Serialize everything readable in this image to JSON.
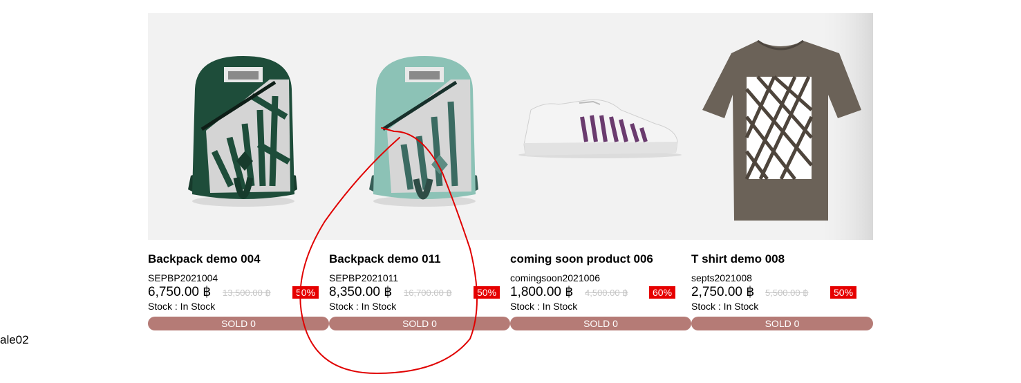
{
  "stray_label": "ale02",
  "products": [
    {
      "title": "Backpack demo 004",
      "sku": "SEPBP2021004",
      "price": "6,750.00 ฿",
      "old_price": "13,500.00 ฿",
      "discount": "50%",
      "stock": "Stock : In Stock",
      "sold": "SOLD 0",
      "image_icon": "dark-green-backpack-image",
      "colors": {
        "body": "#1e4d3a",
        "accent": "#d4d4d4"
      }
    },
    {
      "title": "Backpack demo 011",
      "sku": "SEPBP2021011",
      "price": "8,350.00 ฿",
      "old_price": "16,700.00 ฿",
      "discount": "50%",
      "stock": "Stock : In Stock",
      "sold": "SOLD 0",
      "image_icon": "mint-backpack-image",
      "colors": {
        "body": "#8cc2b6",
        "accent": "#d6d6d6"
      }
    },
    {
      "title": "coming soon product 006",
      "sku": "comingsoon2021006",
      "price": "1,800.00 ฿",
      "old_price": "4,500.00 ฿",
      "discount": "60%",
      "stock": "Stock : In Stock",
      "sold": "SOLD 0",
      "image_icon": "sneaker-image",
      "colors": {
        "body": "#f4f4f4",
        "accent": "#6a3b6e"
      }
    },
    {
      "title": "T shirt demo 008",
      "sku": "septs2021008",
      "price": "2,750.00 ฿",
      "old_price": "5,500.00 ฿",
      "discount": "50%",
      "stock": "Stock : In Stock",
      "sold": "SOLD 0",
      "image_icon": "tshirt-image",
      "colors": {
        "body": "#6b6258",
        "accent": "#ffffff"
      }
    }
  ],
  "theme": {
    "badge": "#e60000",
    "sold_button": "#b57b76",
    "image_bg": "#f2f2f2",
    "annotation": "#e00000"
  }
}
